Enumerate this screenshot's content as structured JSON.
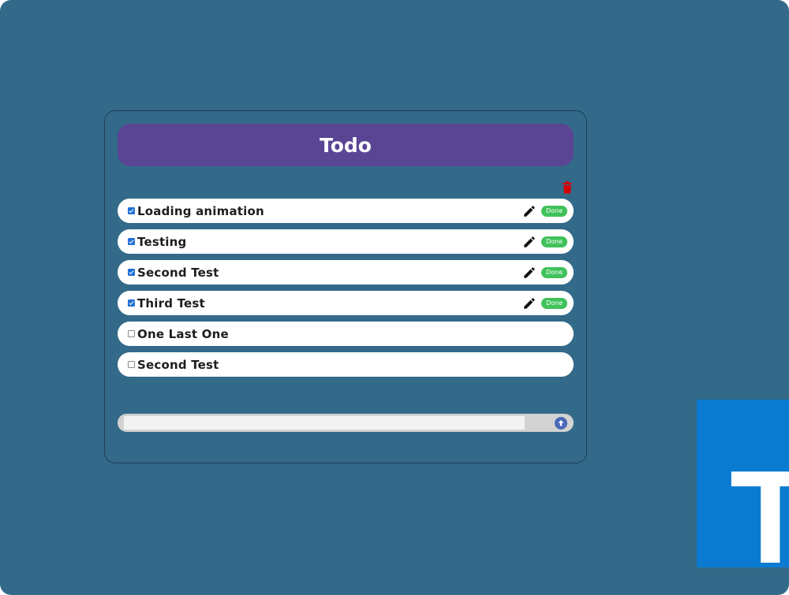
{
  "app": {
    "title": "Todo"
  },
  "toolbar": {
    "delete_icon": "trash-icon",
    "delete_color": "#d40000"
  },
  "todos": [
    {
      "text": "Loading animation",
      "checked": true,
      "show_actions": true,
      "done_label": "Done"
    },
    {
      "text": "Testing",
      "checked": true,
      "show_actions": true,
      "done_label": "Done"
    },
    {
      "text": "Second Test",
      "checked": true,
      "show_actions": true,
      "done_label": "Done"
    },
    {
      "text": "Third Test",
      "checked": true,
      "show_actions": true,
      "done_label": "Done"
    },
    {
      "text": "One Last One",
      "checked": false,
      "show_actions": false,
      "done_label": ""
    },
    {
      "text": "Second Test",
      "checked": false,
      "show_actions": false,
      "done_label": ""
    }
  ],
  "new_todo": {
    "value": "",
    "placeholder": "",
    "submit_icon": "upload-arrow-icon"
  },
  "overlay_logo": {
    "letter": "T",
    "color": "#0a7bd1"
  },
  "colors": {
    "background": "#336a8a",
    "header": "#5a4594",
    "done": "#3fc25a",
    "checkbox": "#1f6fd6"
  }
}
